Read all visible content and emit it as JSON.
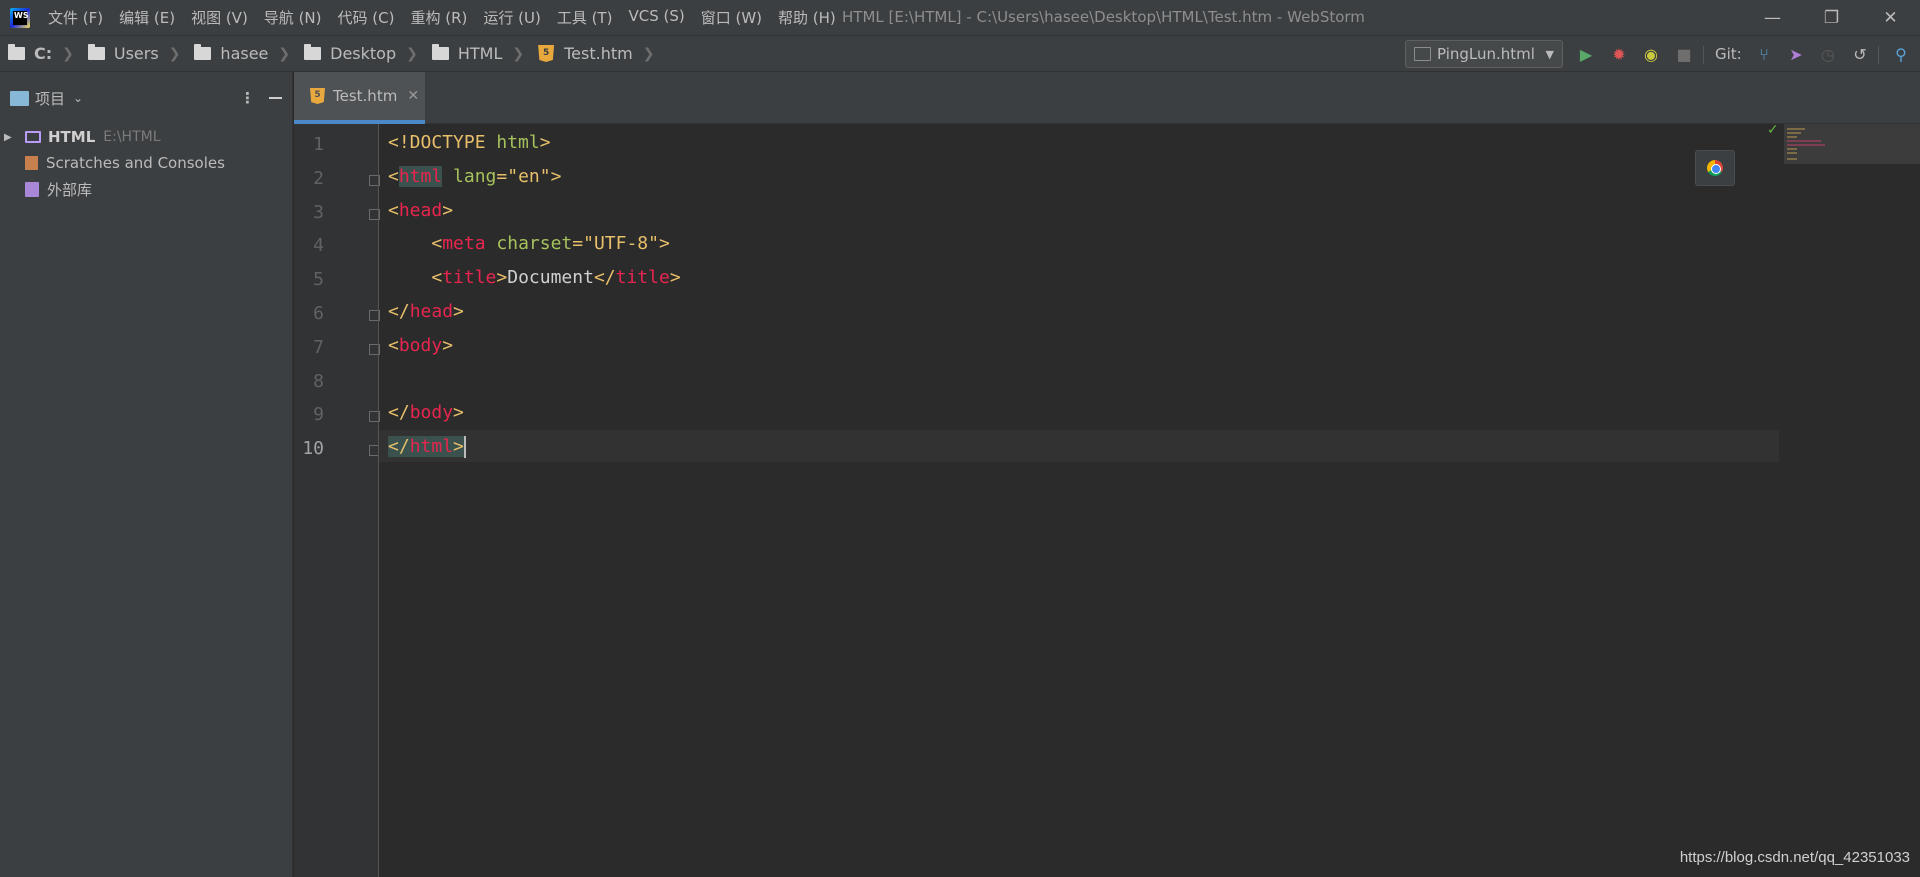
{
  "titlebar": {
    "menu": [
      "文件 (F)",
      "编辑 (E)",
      "视图 (V)",
      "导航 (N)",
      "代码 (C)",
      "重构 (R)",
      "运行 (U)",
      "工具 (T)",
      "VCS (S)",
      "窗口 (W)",
      "帮助 (H)"
    ],
    "window_title": "HTML [E:\\HTML] - C:\\Users\\hasee\\Desktop\\HTML\\Test.htm - WebStorm",
    "controls": {
      "minimize": "—",
      "restore": "❐",
      "close": "✕"
    },
    "logo": "WS"
  },
  "navbar": {
    "crumbs": [
      "C:",
      "Users",
      "hasee",
      "Desktop",
      "HTML",
      "Test.htm"
    ],
    "run_config": "PingLun.html",
    "git_label": "Git:"
  },
  "project_panel": {
    "title": "项目",
    "tree": [
      {
        "name": "HTML",
        "path": "E:\\HTML"
      },
      {
        "name": "Scratches and Consoles"
      },
      {
        "name": "外部库"
      }
    ]
  },
  "editor": {
    "tab_label": "Test.htm",
    "line_numbers": [
      "1",
      "2",
      "3",
      "4",
      "5",
      "6",
      "7",
      "8",
      "9",
      "10"
    ],
    "code": {
      "l1_doctype": "<!DOCTYPE",
      "l1_html": " html",
      "l1_close": ">",
      "l2_open": "<",
      "l2_tag": "html",
      "l2_attr": " lang",
      "l2_eq": "=",
      "l2_val": "\"en\"",
      "l2_close": ">",
      "l3_open": "<",
      "l3_tag": "head",
      "l3_close": ">",
      "l4_open": "<",
      "l4_tag": "meta",
      "l4_attr": " charset",
      "l4_eq": "=",
      "l4_val": "\"UTF-8\"",
      "l4_close": ">",
      "l5_open": "<",
      "l5_tag": "title",
      "l5_mid": ">",
      "l5_text": "Document",
      "l5_open2": "</",
      "l5_tag2": "title",
      "l5_close": ">",
      "l6_open": "</",
      "l6_tag": "head",
      "l6_close": ">",
      "l7_open": "<",
      "l7_tag": "body",
      "l7_close": ">",
      "l9_open": "</",
      "l9_tag": "body",
      "l9_close": ">",
      "l10_open": "</",
      "l10_tag": "html",
      "l10_close": ">"
    }
  },
  "watermark": "https://blog.csdn.net/qq_42351033",
  "colors": {
    "tag": "#e8254f",
    "punctuation": "#e8bf6a",
    "attr_value": "#a5c25c",
    "tab_underline": "#4a88c7"
  }
}
